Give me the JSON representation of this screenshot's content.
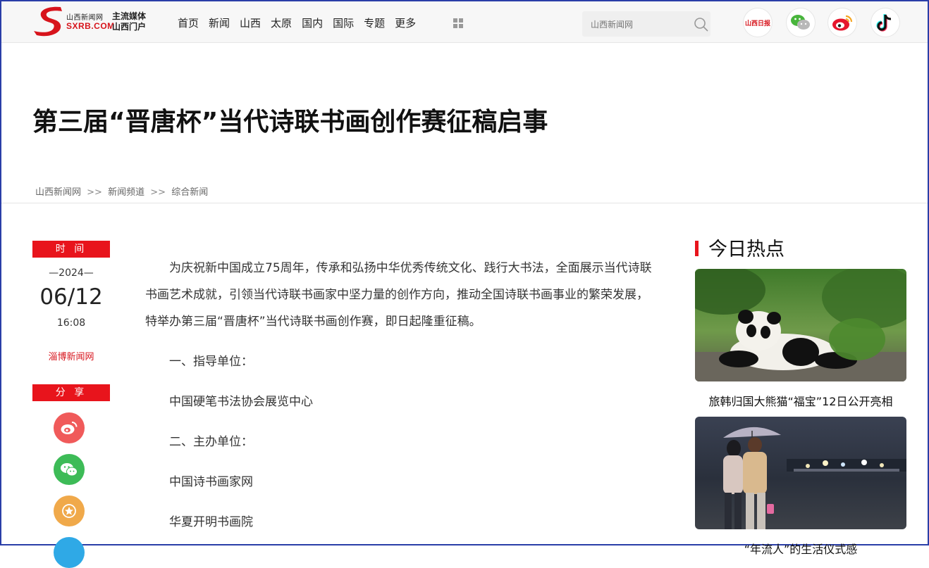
{
  "header": {
    "site_name_cn": "山西新闻网",
    "site_domain": "SXRB.COM",
    "slogan_line1": "主流媒体",
    "slogan_line2": "山西门户",
    "nav": [
      "首页",
      "新闻",
      "山西",
      "太原",
      "国内",
      "国际",
      "专题",
      "更多"
    ],
    "search_placeholder": "山西新闻网",
    "social_icons": [
      "shanxi-daily-icon",
      "wechat-icon",
      "weibo-icon",
      "tiktok-icon"
    ],
    "daily_logo_text": "山西日报"
  },
  "article": {
    "title": "第三届“晋唐杯”当代诗联书画创作赛征稿启事",
    "breadcrumb": [
      "山西新闻网",
      "新闻频道",
      "综合新闻"
    ],
    "breadcrumb_sep": ">>",
    "time_tag": "时 间",
    "year": "—2024—",
    "date": "06/12",
    "time": "16:08",
    "source": "淄博新闻网",
    "share_tag": "分 享",
    "share_icons": [
      "weibo-share-icon",
      "wechat-share-icon",
      "favorite-share-icon",
      "qq-share-icon"
    ],
    "paragraphs": [
      "为庆祝新中国成立75周年，传承和弘扬中华优秀传统文化、践行大书法，全面展示当代诗联书画艺术成就，引领当代诗联书画家中坚力量的创作方向，推动全国诗联书画事业的繁荣发展，特举办第三届“晋唐杯”当代诗联书画创作赛，即日起隆重征稿。",
      "一、指导单位：",
      "中国硬笔书法协会展览中心",
      "二、主办单位：",
      "中国诗书画家网",
      "华夏开明书画院"
    ]
  },
  "sidebar": {
    "title": "今日热点",
    "items": [
      {
        "caption": "旅韩归国大熊猫“福宝”12日公开亮相"
      },
      {
        "caption": "“年流人”的生活仪式感"
      }
    ]
  },
  "colors": {
    "accent_red": "#e8141c",
    "weibo_share": "#f05a5a",
    "wechat_share": "#3dbb57",
    "favorite_share": "#f0a94a",
    "qq_share": "#2fa9e6"
  }
}
